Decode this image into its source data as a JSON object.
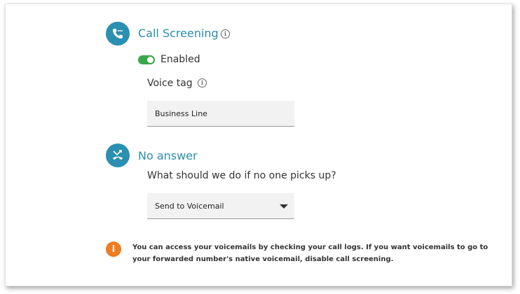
{
  "call_screening": {
    "title": "Call Screening",
    "toggle_label": "Enabled",
    "toggle_on": true,
    "voice_tag_label": "Voice tag",
    "voice_tag_value": "Business Line"
  },
  "no_answer": {
    "title": "No answer",
    "question": "What should we do if no one picks up?",
    "selected_option": "Send to Voicemail"
  },
  "note": {
    "text": "You can access your voicemails by checking your call logs. If you want voicemails to go to your forwarded number's native voicemail, disable call screening."
  },
  "colors": {
    "accent": "#2a8fb0",
    "toggle_on": "#3aa84a",
    "warning": "#ef7b22"
  },
  "icons": {
    "call_screening": "phone-dots-icon",
    "no_answer": "missed-call-icon",
    "info": "info-icon",
    "warning": "warning-icon",
    "dropdown": "chevron-down-icon"
  }
}
